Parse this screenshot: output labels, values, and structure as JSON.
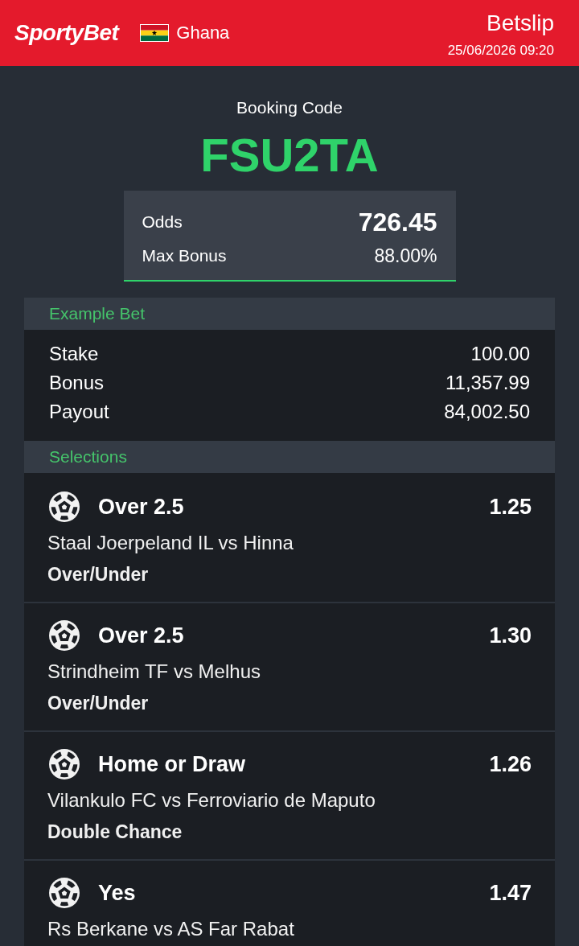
{
  "header": {
    "logo": "SportyBet",
    "country": "Ghana",
    "title": "Betslip",
    "datetime": "25/06/2026 09:20"
  },
  "booking": {
    "label": "Booking Code",
    "code": "FSU2TA",
    "summary": [
      {
        "kind": "odds",
        "label": "Odds",
        "value": "726.45"
      },
      {
        "kind": "bonus",
        "label": "Max Bonus",
        "value": "88.00%"
      }
    ]
  },
  "example_bet": {
    "title": "Example Bet",
    "rows": [
      {
        "label": "Stake",
        "value": "100.00"
      },
      {
        "label": "Bonus",
        "value": "11,357.99"
      },
      {
        "label": "Payout",
        "value": "84,002.50"
      }
    ]
  },
  "selections": {
    "title": "Selections",
    "items": [
      {
        "pick": "Over 2.5",
        "odds": "1.25",
        "match": "Staal Joerpeland IL vs Hinna",
        "market": "Over/Under"
      },
      {
        "pick": "Over 2.5",
        "odds": "1.30",
        "match": "Strindheim TF vs Melhus",
        "market": "Over/Under"
      },
      {
        "pick": "Home or Draw",
        "odds": "1.26",
        "match": "Vilankulo FC vs Ferroviario de Maputo",
        "market": "Double Chance"
      },
      {
        "pick": "Yes",
        "odds": "1.47",
        "match": "Rs Berkane vs AS Far Rabat"
      }
    ]
  }
}
